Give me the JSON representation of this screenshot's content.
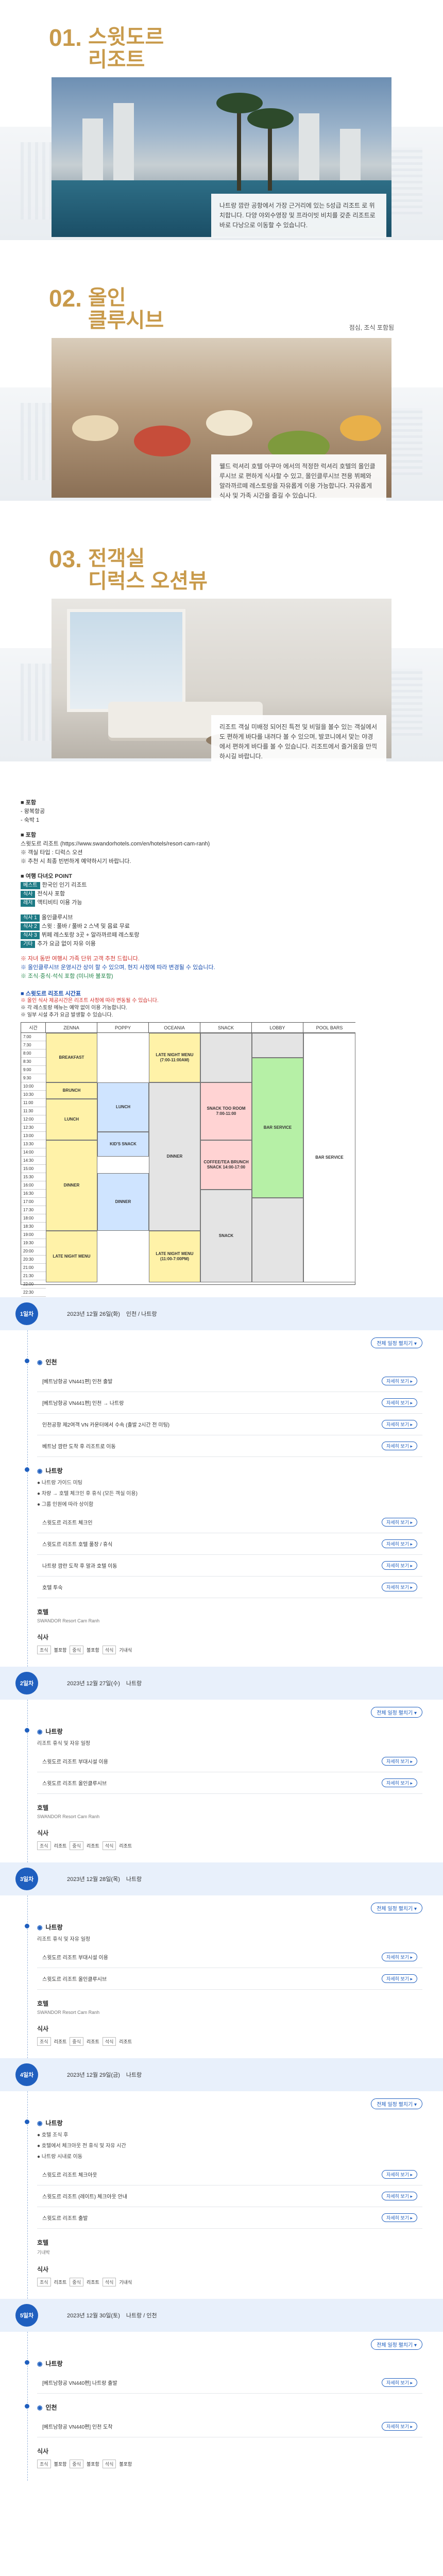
{
  "features": [
    {
      "num": "01.",
      "title_line1": "스윗도르",
      "title_line2": "리조트",
      "note": "",
      "text": "나트랑 깜란 공항에서 가장 근거리에 있는 5성급 리조트 로 위치합니다. 다양 야외수영장 및 프라이빗 비치를 갖춘 리조트로 바로 다낭으로 이동할 수 있습니다."
    },
    {
      "num": "02.",
      "title_line1": "올인",
      "title_line2": "클루시브",
      "note": "점심, 조식 포함됨",
      "text": "웰드 럭셔리 호텔 아쿠아 에서의 적정한 럭셔리 호텔의 올인클루시브 로 편하게 식사할 수 있고, 올인클루시브 전용 뷔페와 알라까르떼 레스토랑을 자유롭게 이용 가능합니다. 자유롭게 식사 및 가족 시간을 즐길 수 있습니다."
    },
    {
      "num": "03.",
      "title_line1": "전객실",
      "title_line2": "디럭스 오션뷰",
      "note": "",
      "text": "리조트 객실 미배정 되어진 특전 및 비밀을 볼수 있는 객실에서도 편하게 바다를 내려다 볼 수 있으며, 발코니에서 맞는 야경에서 편하게 바다를 볼 수 있습니다. 리조트에서 즐거움을 만끽하시길 바랍니다."
    }
  ],
  "info": {
    "sections": [
      {
        "head": "■ 포함",
        "lines": [
          "- 왕복항공",
          "- 숙박 1"
        ]
      },
      {
        "head": "■ 포함",
        "lines": [
          "스윗도르 리조트 (https://www.swandorhotels.com/en/hotels/resort-cam-ranh)",
          "※ 객실 타입 : 디럭스 오션",
          "※ 추천 시 최종 빈번하게 예약하시기 바랍니다."
        ]
      },
      {
        "head": "■ 여행 다녀오 POINT",
        "lines": []
      }
    ],
    "tags": [
      {
        "tag": "베스트",
        "text": "한국인 인기 리조트"
      },
      {
        "tag": "식사",
        "text": "전식사 포함"
      },
      {
        "tag": "레저",
        "text": "액티비티 이용 가능"
      },
      {
        "tag": "식사 1",
        "text": "올인클루시브"
      },
      {
        "tag": "식사 2",
        "text": "스윗 : 풀바 / 풀바 2 스낵 및 음료 무료"
      },
      {
        "tag": "식사 3",
        "text": "뷔페 레스토랑 3곳 + 알라까르떼 레스토랑"
      },
      {
        "tag": "기타",
        "text": "추가 요금 없이 자유 이용"
      }
    ],
    "red_note": "※ 자녀 동반 여행시 가족 단위 고객 추천 드립니다.",
    "blue_note": "※ 올인클루시브 운영시간 상이 할 수 있으며, 현지 사정에 따라 변경될 수 있습니다.",
    "green_note": "※ 조식·중식·석식 포함 (미니바 불포함)"
  },
  "timetable": {
    "title": "■ 스윗도르 리조트 시간표",
    "notes": [
      "※ 올인 식사 제공시간은 리조트 사정에 따라 변동될 수 있습니다.",
      "※ 각 레스토랑 메뉴는 예약 없이 이용 가능합니다.",
      "※ 일부 시설 추가 요금 발생할 수 있습니다."
    ],
    "columns": [
      "시간",
      "ZENNA",
      "POPPY",
      "OCEANIA",
      "SNACK",
      "LOBBY",
      "POOL BARS"
    ],
    "times": [
      "7:00",
      "7:30",
      "8:00",
      "8:30",
      "9:00",
      "9:30",
      "10:00",
      "10:30",
      "11:00",
      "11:30",
      "12:00",
      "12:30",
      "13:00",
      "13:30",
      "14:00",
      "14:30",
      "15:00",
      "15:30",
      "16:00",
      "16:30",
      "17:00",
      "17:30",
      "18:00",
      "18:30",
      "19:00",
      "19:30",
      "20:00",
      "20:30",
      "21:00",
      "21:30",
      "22:00",
      "22:30"
    ],
    "blocks": {
      "z_breakfast": "BREAKFAST",
      "z_brunch": "BRUNCH",
      "z_lunch": "LUNCH",
      "z_dinner": "DINNER",
      "z_late": "LATE NIGHT MENU",
      "p_lunch": "LUNCH",
      "p_kids": "KID'S SNACK",
      "p_dinner": "DINNER",
      "o_late1": "LATE NIGHT MENU (7:00-11:00AM)",
      "o_dinner": "DINNER",
      "o_late2": "LATE NIGHT MENU (11:00-7:00PM)",
      "s_snack": "SNACK TOO ROOM 7:00-11:00",
      "s_coffee": "COFFEE/TEA BRUNCH SNACK 14:00-17:00",
      "s_snack2": "SNACK",
      "l_bar": "BAR SERVICE",
      "pool_bar": "BAR SERVICE"
    }
  },
  "itinerary": {
    "expand_all": "전체 일정 펼치기 ▾",
    "detail_label": "자세히 보기 ▸",
    "meal_labels": [
      "조식",
      "중식",
      "석식"
    ],
    "days": [
      {
        "badge": "1일차",
        "date": "2023년 12월 26일(화)",
        "sub": "인천 / 나트랑",
        "regions": [
          {
            "name": "인천",
            "notes": [],
            "items": [
              "[베트남항공 VN441편] 인천 출발",
              "[베트남항공 VN441편] 인천 → 나트랑",
              "인천공항 제2여객 VN 카운터에서 수속 (출발 2시간 전 미팅)",
              "베트남 깜란 도착 후 리조트로 이동"
            ]
          },
          {
            "name": "나트랑",
            "notes": [
              "● 나트랑 가이드 미팅",
              "● 차량 → 호텔 체크인 후 휴식 (모든 객실 이용)",
              "● 그룹 인원에 따라 상이함"
            ],
            "items": [
              "스윗도르 리조트 체크인",
              "스윗도르 리조트 호텔 풀장 / 휴식",
              "나트랑 깜란 도착 후 말과 호텔 이동",
              "호텔 투숙"
            ]
          }
        ],
        "hotel": "호텔",
        "hotel_name": "SWANDOR Resort Cam Ranh",
        "meals": [
          "불포함",
          "불포함",
          "기내식"
        ]
      },
      {
        "badge": "2일차",
        "date": "2023년 12월 27일(수)",
        "sub": "나트랑",
        "regions": [
          {
            "name": "나트랑",
            "notes": [
              "리조트 휴식 및 자유 일정"
            ],
            "items": [
              "스윗도르 리조트 부대시설 이용",
              "스윗도르 리조트 올인클루시브"
            ]
          }
        ],
        "hotel": "호텔",
        "hotel_name": "SWANDOR Resort Cam Ranh",
        "meals": [
          "리조트",
          "리조트",
          "리조트"
        ]
      },
      {
        "badge": "3일차",
        "date": "2023년 12월 28일(목)",
        "sub": "나트랑",
        "regions": [
          {
            "name": "나트랑",
            "notes": [
              "리조트 휴식 및 자유 일정"
            ],
            "items": [
              "스윗도르 리조트 부대시설 이용",
              "스윗도르 리조트 올인클루시브"
            ]
          }
        ],
        "hotel": "호텔",
        "hotel_name": "SWANDOR Resort Cam Ranh",
        "meals": [
          "리조트",
          "리조트",
          "리조트"
        ]
      },
      {
        "badge": "4일차",
        "date": "2023년 12월 29일(금)",
        "sub": "나트랑",
        "regions": [
          {
            "name": "나트랑",
            "notes": [
              "● 호텔 조식 후",
              "● 호텔에서 체크아웃 전 휴식 및 자유 시간",
              "● 나트랑 시내로 이동"
            ],
            "items": [
              "스윗도르 리조트 체크아웃",
              "스윗도르 리조트 (레이트) 체크아웃 안내",
              "스윗도르 리조트 출발"
            ]
          }
        ],
        "hotel": "호텔",
        "hotel_name": "기내박",
        "meals": [
          "리조트",
          "리조트",
          "기내식"
        ]
      },
      {
        "badge": "5일차",
        "date": "2023년 12월 30일(토)",
        "sub": "나트랑 / 인천",
        "regions": [
          {
            "name": "나트랑",
            "notes": [],
            "items": [
              "[베트남항공 VN440편] 나트랑 출발"
            ]
          },
          {
            "name": "인천",
            "notes": [],
            "items": [
              "[베트남항공 VN440편] 인천 도착"
            ]
          }
        ],
        "hotel": "",
        "hotel_name": "",
        "meals": [
          "불포함",
          "불포함",
          "불포함"
        ]
      }
    ]
  },
  "colors": {
    "gold": "#c89a4b",
    "blue": "#1f5fbf",
    "teal": "#1d7a85",
    "yellow": "#fff2a8",
    "lightblue": "#cfe4ff",
    "green": "#b6f0a6",
    "pink": "#ffd3d3",
    "gray": "#e4e4e4"
  }
}
